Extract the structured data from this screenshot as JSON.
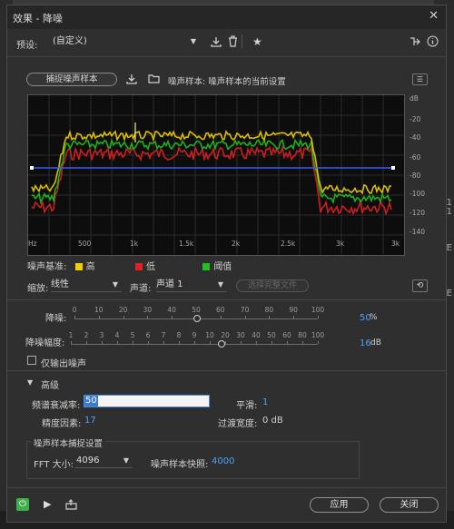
{
  "window": {
    "title": "效果 - 降噪",
    "close_glyph": "✕"
  },
  "presets": {
    "label": "预设:",
    "value": "(自定义)"
  },
  "capture": {
    "button_label": "捕捉噪声样本",
    "status_text": "噪声样本: 噪声样本的当前设置"
  },
  "graph": {
    "db_ticks": [
      "dB",
      "-20",
      "-40",
      "-60",
      "-80",
      "-100",
      "-120",
      "-140"
    ],
    "hz_ticks": [
      "Hz",
      "500",
      "1k",
      "1.5k",
      "2k",
      "2.5k",
      "3k",
      "3k"
    ]
  },
  "legend": {
    "label": "噪声基准:",
    "items": [
      {
        "name": "高",
        "color": "#f0d000"
      },
      {
        "name": "低",
        "color": "#e02020"
      },
      {
        "name": "阈值",
        "color": "#20c020"
      }
    ]
  },
  "scale": {
    "label": "缩放:",
    "value": "线性"
  },
  "channel": {
    "label": "声道:",
    "value": "声道 1"
  },
  "select_entire_file": "选择完整文件",
  "noise_reduction": {
    "label": "降噪:",
    "ticks": [
      "0",
      "10",
      "20",
      "30",
      "40",
      "50",
      "60",
      "70",
      "80",
      "90",
      "100"
    ],
    "value": "50",
    "unit": "%"
  },
  "reduce_by": {
    "label": "降噪幅度:",
    "ticks": [
      "1",
      "2",
      "3",
      "4",
      "5",
      "6",
      "7",
      "8",
      "9",
      "10",
      "20",
      "30",
      "40",
      "50",
      "60",
      "80",
      "100"
    ],
    "value": "16",
    "unit": "dB"
  },
  "output_noise_only": "仅输出噪声",
  "advanced": {
    "header": "高级",
    "spectral_decay_label": "频谱衰减率:",
    "spectral_decay_value": "50",
    "smoothing_label": "平滑:",
    "smoothing_value": "1",
    "precision_label": "精度因素:",
    "precision_value": "17",
    "transition_label": "过渡宽度:",
    "transition_value": "0 dB"
  },
  "capture_settings": {
    "title": "噪声样本捕捉设置",
    "fft_label": "FFT 大小:",
    "fft_value": "4096",
    "snapshots_label": "噪声样本快照:",
    "snapshots_value": "4000"
  },
  "footer": {
    "apply": "应用",
    "close": "关闭"
  },
  "background_right_text": [
    "1",
    "1",
    "(E",
    "(E"
  ],
  "colors": {
    "accent_blue": "#4ca0ff",
    "power_green": "#3fb04a"
  }
}
